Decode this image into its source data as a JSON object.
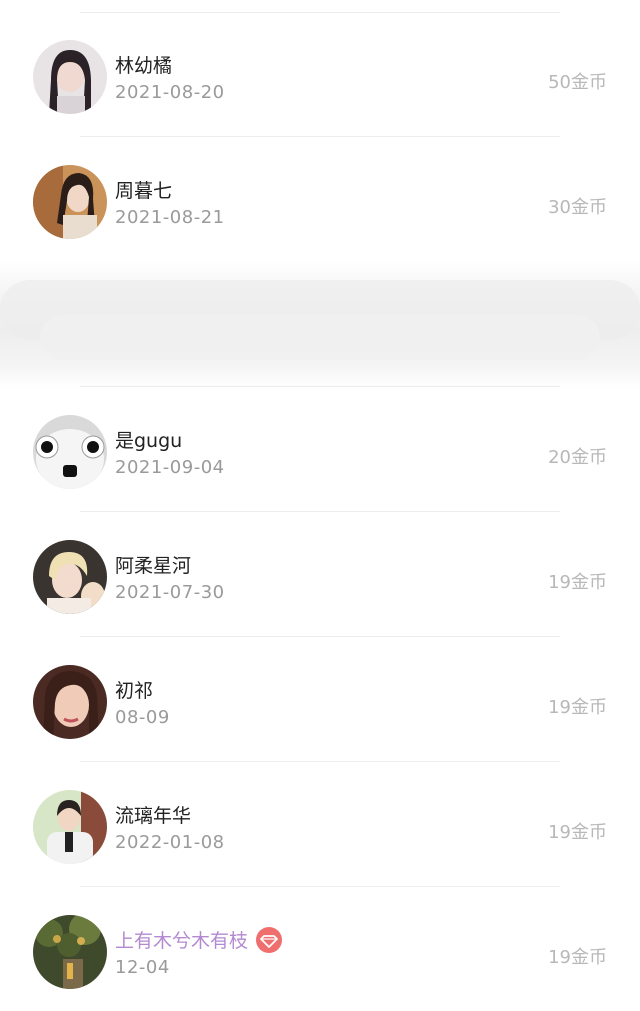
{
  "users": [
    {
      "name": "林幼橘",
      "date": "2021-08-20",
      "coins": "50金币"
    },
    {
      "name": "周暮七",
      "date": "2021-08-21",
      "coins": "30金币"
    },
    {
      "name": "是gugu",
      "date": "2021-09-04",
      "coins": "20金币"
    },
    {
      "name": "阿柔星河",
      "date": "2021-07-30",
      "coins": "19金币"
    },
    {
      "name": "初祁",
      "date": "08-09",
      "coins": "19金币"
    },
    {
      "name": "流璃年华",
      "date": "2022-01-08",
      "coins": "19金币"
    },
    {
      "name": "上有木兮木有枝",
      "date": "12-04",
      "coins": "19金币",
      "vip": true
    }
  ],
  "colors": {
    "name": "#222222",
    "vip_name": "#b38ad1",
    "date": "#9a9a9a",
    "coins": "#b8b8b8",
    "vip_badge": "#ef6e6e"
  }
}
